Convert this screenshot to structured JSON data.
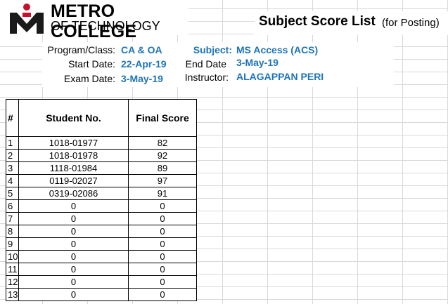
{
  "header": {
    "logo_line1": "METRO COLLEGE",
    "logo_line2": "OF TECHNOLOGY",
    "title": "Subject Score List",
    "title_note": "(for Posting)"
  },
  "info": {
    "program_label": "Program/Class:",
    "program_value": "CA & OA",
    "start_label": "Start Date:",
    "start_value": "22-Apr-19",
    "exam_label": "Exam Date:",
    "exam_value": "3-May-19",
    "subject_label": "Subject:",
    "subject_value": "MS Access (ACS)",
    "end_label": "End Date",
    "end_value": "3-May-19",
    "instructor_label": "Instructor:",
    "instructor_value": "ALAGAPPAN PERI"
  },
  "table": {
    "headers": [
      "#",
      "Student No.",
      "Final Score"
    ],
    "rows": [
      [
        "1",
        "1018-01977",
        "82"
      ],
      [
        "2",
        "1018-01978",
        "92"
      ],
      [
        "3",
        "1118-01984",
        "89"
      ],
      [
        "4",
        "0119-02027",
        "97"
      ],
      [
        "5",
        "0319-02086",
        "91"
      ],
      [
        "6",
        "0",
        "0"
      ],
      [
        "7",
        "0",
        "0"
      ],
      [
        "8",
        "0",
        "0"
      ],
      [
        "9",
        "0",
        "0"
      ],
      [
        "10",
        "0",
        "0"
      ],
      [
        "11",
        "0",
        "0"
      ],
      [
        "12",
        "0",
        "0"
      ],
      [
        "13",
        "0",
        "0"
      ]
    ]
  },
  "colors": {
    "accent_blue": "#1e74b8",
    "logo_red": "#c8102e"
  }
}
